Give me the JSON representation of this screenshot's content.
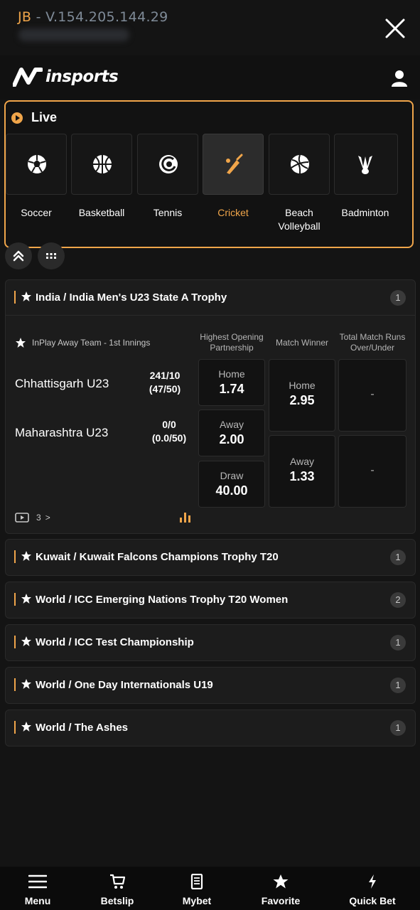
{
  "topbar": {
    "prefix": "JB",
    "version": "- V.154.205.144.29",
    "close_icon": "close-icon"
  },
  "header": {
    "logo_text": "insports",
    "user_icon": "user-icon"
  },
  "live": {
    "title": "Live",
    "sports": [
      {
        "name": "Soccer",
        "icon": "soccer-ball-icon",
        "active": false
      },
      {
        "name": "Basketball",
        "icon": "basketball-icon",
        "active": false
      },
      {
        "name": "Tennis",
        "icon": "tennis-icon",
        "active": false
      },
      {
        "name": "Cricket",
        "icon": "cricket-icon",
        "active": true
      },
      {
        "name": "Beach\nVolleyball",
        "icon": "volleyball-icon",
        "active": false
      },
      {
        "name": "Badminton",
        "icon": "shuttlecock-icon",
        "active": false
      }
    ]
  },
  "controls": {
    "collapse_icon": "double-chevron-up-icon",
    "grid_icon": "grid-dots-icon"
  },
  "match": {
    "league": "India / India Men's U23 State A Trophy",
    "league_count": "1",
    "inplay_text": "InPlay Away Team - 1st Innings",
    "columns": {
      "col1": "Highest Opening\nPartnership",
      "col2": "Match Winner",
      "col3": "Total Match Runs\nOver/Under"
    },
    "home_team": "Chhattisgarh U23",
    "home_score": "241/10",
    "home_overs": "(47/50)",
    "away_team": "Maharashtra U23",
    "away_score": "0/0",
    "away_overs": "(0.0/50)",
    "partnership": [
      {
        "label": "Home",
        "value": "1.74"
      },
      {
        "label": "Away",
        "value": "2.00"
      },
      {
        "label": "Draw",
        "value": "40.00"
      }
    ],
    "winner": [
      {
        "label": "Home",
        "value": "2.95"
      },
      {
        "label": "Away",
        "value": "1.33"
      }
    ],
    "totals": [
      "-",
      "-"
    ],
    "media_count": "3",
    "media_chevron": ">"
  },
  "leagues": [
    {
      "name": "Kuwait / Kuwait Falcons Champions Trophy T20",
      "count": "1"
    },
    {
      "name": "World / ICC Emerging Nations Trophy T20 Women",
      "count": "2"
    },
    {
      "name": "World / ICC Test Championship",
      "count": "1"
    },
    {
      "name": "World / One Day Internationals U19",
      "count": "1"
    },
    {
      "name": "World / The Ashes",
      "count": "1"
    }
  ],
  "bottom_nav": [
    {
      "label": "Menu",
      "icon": "hamburger-menu-icon"
    },
    {
      "label": "Betslip",
      "icon": "cart-icon"
    },
    {
      "label": "Mybet",
      "icon": "receipt-icon"
    },
    {
      "label": "Favorite",
      "icon": "star-icon"
    },
    {
      "label": "Quick Bet",
      "icon": "lightning-icon"
    }
  ],
  "colors": {
    "accent": "#f0a54a",
    "background": "#141414",
    "card": "#1c1c1c"
  }
}
